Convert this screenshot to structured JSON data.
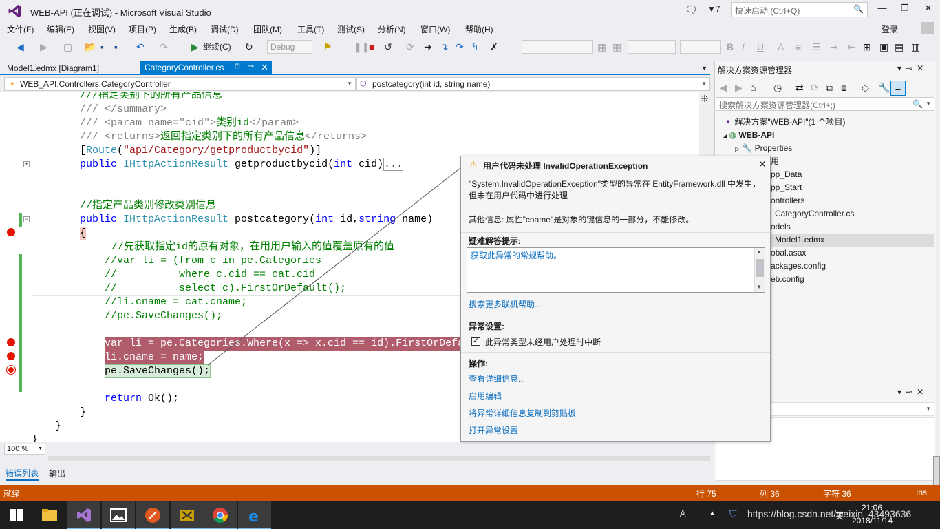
{
  "window": {
    "title": "WEB-API (正在调试) - Microsoft Visual Studio",
    "notification_count": "7",
    "quick_launch_placeholder": "快速启动 (Ctrl+Q)",
    "login_label": "登录"
  },
  "menu": [
    "文件(F)",
    "编辑(E)",
    "视图(V)",
    "项目(P)",
    "生成(B)",
    "调试(D)",
    "团队(M)",
    "工具(T)",
    "测试(S)",
    "分析(N)",
    "窗口(W)",
    "帮助(H)"
  ],
  "toolbar": {
    "continue_label": "继续(C)",
    "config_value": "Debug"
  },
  "doc_tabs": {
    "inactive": "Model1.edmx [Diagram1]",
    "active": "CategoryController.cs"
  },
  "navbar": {
    "class_path": "WEB_API.Controllers.CategoryController",
    "member": "postcategory(int id, string name)"
  },
  "code": {
    "l0": "///指定类别下的所有产品信息",
    "l1": "/// </summary>",
    "l2a": "/// <param name=\"cid\">",
    "l2b": "类别id",
    "l2c": "</param>",
    "l3a": "/// <returns>",
    "l3b": "返回指定类别下的所有产品信息",
    "l3c": "</returns>",
    "l4a": "[",
    "l4b": "Route",
    "l4c": "(",
    "l4d": "\"api/Category/getproductbycid\"",
    "l4e": ")]",
    "l5a": "public ",
    "l5b": "IHttpActionResult",
    "l5c": " getproductbycid(",
    "l5d": "int",
    "l5e": " cid)",
    "l5f": "...",
    "l8": "//指定产品类别修改类别信息",
    "l9a": "public ",
    "l9b": "IHttpActionResult",
    "l9c": " postcategory(",
    "l9d": "int",
    "l9e": " id,",
    "l9f": "string",
    "l9g": " name)",
    "l10": "{",
    "l11": "//先获取指定id的原有对象，在用用户输入的值覆盖原有的值",
    "l12": "//var li = (from c in pe.Categories",
    "l13": "//          where c.cid == cat.cid",
    "l14": "//          select c).FirstOrDefault();",
    "l15": "//li.cname = cat.cname;",
    "l16": "//pe.SaveChanges();",
    "l18": "var li = pe.Categories.Where(x => x.cid == id).FirstOrDefault();",
    "l19": "li.cname = name;",
    "l20": "pe.SaveChanges();",
    "l22a": "return ",
    "l22b": "Ok();",
    "l23": "}",
    "l24": "}",
    "l25": "}"
  },
  "zoom": "100 %",
  "bottom_tabs": {
    "errors": "错误列表",
    "output": "输出"
  },
  "status": {
    "text": "就绪",
    "line": "行 75",
    "col": "列 36",
    "char": "字符 36",
    "mode": "Ins"
  },
  "solution_explorer": {
    "title": "解决方案资源管理器",
    "search_placeholder": "搜索解决方案资源管理器(Ctrl+;)",
    "solution": "解决方案\"WEB-API\"(1 个项目)",
    "project": "WEB-API",
    "items": [
      "Properties",
      "用",
      "pp_Data",
      "pp_Start",
      "ontrollers",
      "CategoryController.cs",
      "odels",
      "Model1.edmx",
      "obal.asax",
      "ackages.config",
      "eb.config"
    ]
  },
  "exception": {
    "title": "用户代码未处理 InvalidOperationException",
    "message": "\"System.InvalidOperationException\"类型的异常在 EntityFramework.dll 中发生，但未在用户代码中进行处理",
    "extra_info": "其他信息: 属性\"cname\"是对象的键信息的一部分，不能修改。",
    "tips_header": "疑难解答提示:",
    "tips_link": "获取此异常的常规帮助。",
    "more_help_link": "搜索更多联机帮助...",
    "settings_header": "异常设置:",
    "checkbox_label": "此异常类型未经用户处理时中断",
    "checkbox_checked": true,
    "actions_header": "操作:",
    "actions": [
      "查看详细信息...",
      "启用编辑",
      "将异常详细信息复制到剪贴板",
      "打开异常设置"
    ]
  },
  "taskbar": {
    "tray_text": "https://blog.csdn.net/weixin_43493636",
    "ime": "英",
    "time": "21:06",
    "date": "2018/11/14"
  },
  "colors": {
    "accent": "#007acc",
    "status_bar": "#ca5100",
    "breakpoint": "#e51400",
    "breakpoint_highlight": "#b15c6b",
    "current_line": "#d7ecd8"
  }
}
